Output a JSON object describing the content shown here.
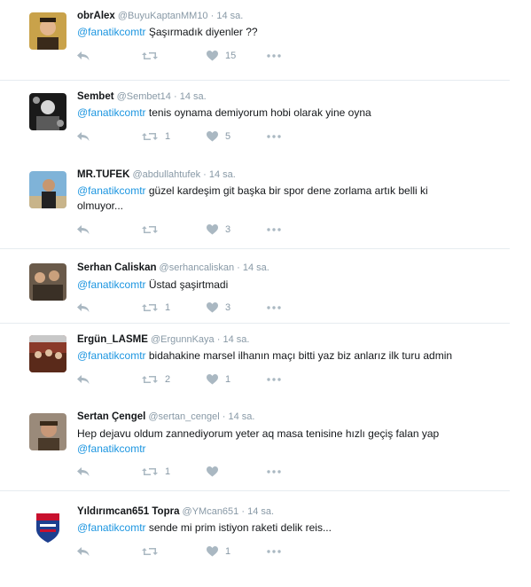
{
  "colors": {
    "link": "#1b95e0",
    "muted": "#8899a6",
    "icon": "#aab8c2",
    "divider": "#e6ecf0"
  },
  "tweets": [
    {
      "name": "obrAlex",
      "handle": "@BuyuKaptanMM10",
      "time": "14 sa.",
      "mention": "@fanatikcomtr",
      "text": " Şaşırmadık diyenler ??",
      "text2": "",
      "retweets": "",
      "likes": "15"
    },
    {
      "name": "Sembet",
      "handle": "@Sembet14",
      "time": "14 sa.",
      "mention": "@fanatikcomtr",
      "text": " tenis oynama demiyorum hobi olarak yine oyna",
      "text2": "",
      "retweets": "1",
      "likes": "5"
    },
    {
      "name": "MR.TUFEK",
      "handle": "@abdullahtufek",
      "time": "14 sa.",
      "mention": "@fanatikcomtr",
      "text": " güzel kardeşim git başka bir spor dene zorlama artık belli ki",
      "text2": "olmuyor...",
      "retweets": "",
      "likes": "3"
    },
    {
      "name": "Serhan Caliskan",
      "handle": "@serhancaliskan",
      "time": "14 sa.",
      "mention": "@fanatikcomtr",
      "text": " Üstad şaşirtmadi",
      "text2": "",
      "retweets": "1",
      "likes": "3"
    },
    {
      "name": "Ergün_LASME",
      "handle": "@ErgunnKaya",
      "time": "14 sa.",
      "mention": "@fanatikcomtr",
      "text": " bidahakine marsel ilhanın maçı bitti yaz biz anlarız ilk turu admin",
      "text2": "",
      "retweets": "2",
      "likes": "1"
    },
    {
      "name": "Sertan Çengel",
      "handle": "@sertan_cengel",
      "time": "14 sa.",
      "mention": "@fanatikcomtr",
      "text": "",
      "lead": "Hep dejavu oldum zannediyorum yeter aq masa tenisine hızlı geçiş falan yap",
      "text2": "",
      "retweets": "1",
      "likes": ""
    },
    {
      "name": "Yıldırımcan651 Topra",
      "handle": "@YMcan651",
      "time": "14 sa.",
      "mention": "@fanatikcomtr",
      "text": " sende mi prim istiyon raketi delik reis...",
      "text2": "",
      "retweets": "",
      "likes": "1"
    }
  ],
  "icons": {
    "reply": "reply-icon",
    "retweet": "retweet-icon",
    "like": "heart-icon",
    "more": "more-icon"
  }
}
